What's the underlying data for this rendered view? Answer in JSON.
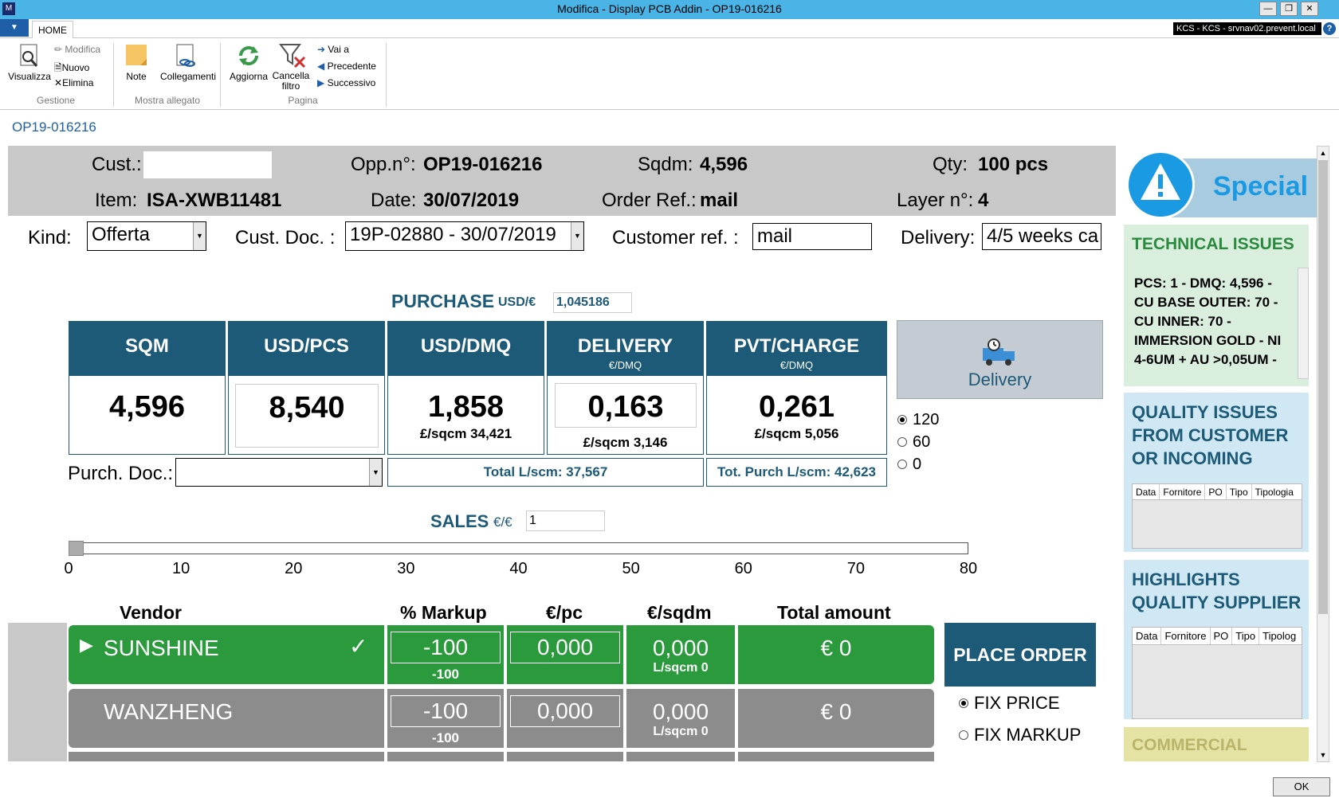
{
  "window": {
    "title": "Modifica - Display PCB Addin - OP19-016216"
  },
  "ribbon": {
    "tab": "HOME",
    "server": "KCS - KCS - srvnav02.prevent.local",
    "help": "?",
    "gestione": {
      "visualizza": "Visualizza",
      "modifica": "Modifica",
      "nuovo": "Nuovo",
      "elimina": "Elimina",
      "label": "Gestione"
    },
    "mostra": {
      "note": "Note",
      "collegamenti": "Collegamenti",
      "label": "Mostra allegato"
    },
    "pagina": {
      "aggiorna": "Aggiorna",
      "cancella": "Cancella",
      "filtro": "filtro",
      "vai": "Vai a",
      "precedente": "Precedente",
      "successivo": "Successivo",
      "label": "Pagina"
    }
  },
  "breadcrumb": "OP19-016216",
  "header": {
    "cust_label": "Cust.:",
    "cust_value": "",
    "opp_label": "Opp.n°:",
    "opp_value": "OP19-016216",
    "sqdm_label": "Sqdm:",
    "sqdm_value": "4,596",
    "qty_label": "Qty:",
    "qty_value": "100 pcs",
    "item_label": "Item:",
    "item_value": "ISA-XWB11481",
    "date_label": "Date:",
    "date_value": "30/07/2019",
    "orderref_label": "Order Ref.:",
    "orderref_value": "mail",
    "layer_label": "Layer n°:",
    "layer_value": "4"
  },
  "form": {
    "kind_label": "Kind:",
    "kind_value": "Offerta",
    "custdoc_label": "Cust. Doc. :",
    "custdoc_value": "19P-02880 - 30/07/2019",
    "custref_label": "Customer ref. :",
    "custref_value": "mail",
    "delivery_label": "Delivery:",
    "delivery_value": "4/5 weeks ca"
  },
  "purchase": {
    "title": "PURCHASE",
    "currency": "USD/€",
    "rate": "1,045186",
    "cols": [
      {
        "title": "SQM",
        "sub": "",
        "value": "4,596",
        "foot": ""
      },
      {
        "title": "USD/PCS",
        "sub": "",
        "value": "8,540",
        "foot": ""
      },
      {
        "title": "USD/DMQ",
        "sub": "",
        "value": "1,858",
        "foot": "£/sqcm 34,421"
      },
      {
        "title": "DELIVERY",
        "sub": "€/DMQ",
        "value": "0,163",
        "foot": "£/sqcm 3,146"
      },
      {
        "title": "PVT/CHARGE",
        "sub": "€/DMQ",
        "value": "0,261",
        "foot": "£/sqcm 5,056"
      }
    ],
    "total": "Total L/scm: 37,567",
    "tot_purch": "Tot. Purch L/scm: 42,623",
    "purchdoc_label": "Purch. Doc.:",
    "delivery_button": "Delivery",
    "delivery_options": [
      "120",
      "60",
      "0"
    ],
    "delivery_selected": "120"
  },
  "sales": {
    "title": "SALES",
    "currency": "€/€",
    "rate": "1",
    "slider_value": 0,
    "slider_min": 0,
    "slider_max": 80,
    "ticks": [
      "0",
      "10",
      "20",
      "30",
      "40",
      "50",
      "60",
      "70",
      "80"
    ]
  },
  "vendors": {
    "headers": {
      "vendor": "Vendor",
      "markup": "% Markup",
      "eurpc": "€/pc",
      "eursqdm": "€/sqdm",
      "total": "Total amount"
    },
    "rows": [
      {
        "name": "SUNSHINE",
        "markup": "-100",
        "markup_sub": "-100",
        "eurpc": "0,000",
        "eursqdm": "0,000",
        "lsqcm": "L/sqcm 0",
        "total": "€ 0",
        "selected": true
      },
      {
        "name": "WANZHENG",
        "markup": "-100",
        "markup_sub": "-100",
        "eurpc": "0,000",
        "eursqdm": "0,000",
        "lsqcm": "L/sqcm 0",
        "total": "€ 0",
        "selected": false
      }
    ]
  },
  "order": {
    "place": "PLACE ORDER",
    "fix_price": "FIX PRICE",
    "fix_markup": "FIX MARKUP",
    "selected": "FIX PRICE"
  },
  "sidebar": {
    "special": "Special",
    "technical_title": "TECHNICAL ISSUES",
    "technical_lines": [
      "PCS: 1 - DMQ: 4,596 -",
      "CU BASE OUTER: 70 -",
      "CU INNER: 70 -",
      "IMMERSION GOLD - NI",
      "4-6UM + AU >0,05UM -"
    ],
    "quality_title": [
      "QUALITY ISSUES",
      "FROM CUSTOMER",
      "OR INCOMING"
    ],
    "quality_cols": [
      "Data",
      "Fornitore",
      "PO",
      "Tipo",
      "Tipologia"
    ],
    "highlights_title": [
      "HIGHLIGHTS",
      "QUALITY SUPPLIER"
    ],
    "highlights_cols": [
      "Data",
      "Fornitore",
      "PO",
      "Tipo",
      "Tipolog"
    ],
    "commercial_title": "COMMERCIAL"
  },
  "footer": {
    "ok": "OK"
  },
  "colors": {
    "titlebar": "#4ab4e6",
    "teal": "#1c5a78",
    "green": "#2a9a3c",
    "grey": "#8c8c8c",
    "side_green": "#d9eedd",
    "side_blue": "#cfe8f3",
    "side_yellow": "#e4e3a4"
  }
}
